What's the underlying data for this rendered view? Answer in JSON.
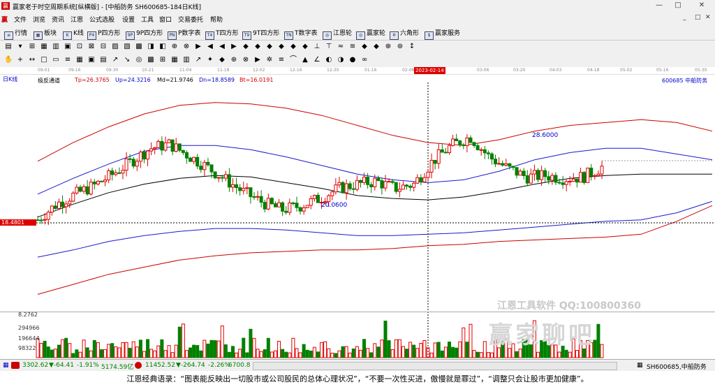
{
  "window": {
    "title": "赢家老于时空周期系统[纵横版] - [中船防务  SH600685-184日K线]",
    "min": "—",
    "max": "□",
    "close": "✕"
  },
  "menu": [
    "文件",
    "浏览",
    "资讯",
    "江恩",
    "公式选股",
    "设置",
    "工具",
    "窗口",
    "交易委托",
    "帮助"
  ],
  "mdi": [
    "_",
    "□",
    "✕"
  ],
  "nav": [
    {
      "label": "行情",
      "icon": "≡"
    },
    {
      "label": "板块",
      "icon": "▦"
    },
    {
      "label": "K线",
      "icon": "K"
    },
    {
      "label": "P四方形",
      "icon": "P4"
    },
    {
      "label": "9P四方形",
      "icon": "9P"
    },
    {
      "label": "P数字表",
      "icon": "PN"
    },
    {
      "label": "T四方形",
      "icon": "T4"
    },
    {
      "label": "9T四方形",
      "icon": "T9"
    },
    {
      "label": "T数字表",
      "icon": "TN"
    },
    {
      "label": "江恩轮",
      "icon": "◎"
    },
    {
      "label": "赢家轮",
      "icon": "◎"
    },
    {
      "label": "六角形",
      "icon": "✡"
    },
    {
      "label": "赢家服务",
      "icon": "$"
    }
  ],
  "dates": [
    "09-01",
    "09-16",
    "09-30",
    "10-21",
    "11-04",
    "11-18",
    "12-02",
    "12-16",
    "12-30",
    "01-16",
    "02-06",
    "02-14",
    "03-06",
    "03-20",
    "04-03",
    "04-18",
    "05-02",
    "05-16",
    "05-30"
  ],
  "highlight_date": "2023-02-14",
  "period": "日K线",
  "indicator": {
    "name": "极反通道",
    "tp": "Tp=26.3765",
    "up": "Up=24.3216",
    "md": "Md=21.9746",
    "dn": "Dn=18.8589",
    "bt": "Bt=16.0191"
  },
  "stock": "600685  中船防务",
  "annotations": {
    "high": "28.6000",
    "low": "20.0600"
  },
  "cursor_price": "18.4801",
  "volume_labels": {
    "top": "8.2762",
    "v1": "294966",
    "v2": "196644",
    "v3": "98322"
  },
  "watermark": {
    "line1": "江恩工具软件  QQ:100800360",
    "line2": "赢家聊吧"
  },
  "status": {
    "sh": "3302.62",
    "sh_chg": "▼-64.41",
    "sh_pct": "-1.91%",
    "sh_amt": "5174.59亿",
    "sz": "11452.52",
    "sz_chg": "▼-264.74",
    "sz_pct": "-2.26%",
    "sz_amt": "6700.8",
    "right": "SH600685,中船防务"
  },
  "quote": "江恩经典语录：“图表能反映出一切股市或公司股民的总体心理状况”，“不要一次性买进，傲慢就是罪过”，“调整只会让股市更加健康”。",
  "colors": {
    "up": "#e00000",
    "down": "#008000",
    "mid": "#000000",
    "band_blue": "#1a1acc",
    "band_red": "#cc0000"
  },
  "chart_data": {
    "type": "candlestick",
    "series": [
      {
        "name": "Tp",
        "values": [
          23.5,
          24.8,
          25.9,
          26.8,
          27.4,
          27.6,
          27.5,
          27.2,
          26.7,
          26.0,
          25.3,
          24.8,
          24.6,
          25.0,
          25.6,
          26.0,
          26.2,
          26.4,
          26.2,
          25.6
        ]
      },
      {
        "name": "Up",
        "values": [
          21.2,
          22.3,
          23.3,
          24.2,
          24.6,
          24.6,
          24.3,
          23.8,
          23.2,
          22.6,
          22.2,
          22.0,
          22.2,
          22.8,
          23.6,
          24.1,
          24.4,
          24.4,
          24.0,
          23.6
        ]
      },
      {
        "name": "Md",
        "values": [
          19.6,
          20.5,
          21.3,
          21.9,
          22.3,
          22.5,
          22.4,
          22.0,
          21.6,
          21.1,
          20.9,
          20.8,
          21.0,
          21.4,
          21.9,
          22.3,
          22.5,
          22.6,
          22.6,
          22.6
        ]
      },
      {
        "name": "Dn",
        "values": [
          16.8,
          17.3,
          17.9,
          18.3,
          18.6,
          18.8,
          18.8,
          18.7,
          18.5,
          18.3,
          18.3,
          18.4,
          18.5,
          18.7,
          18.9,
          19.1,
          19.3,
          19.4,
          19.9,
          20.7
        ]
      },
      {
        "name": "Bt",
        "values": [
          14.2,
          14.9,
          15.6,
          16.1,
          16.6,
          16.9,
          17.1,
          17.2,
          17.3,
          17.3,
          17.4,
          17.6,
          17.7,
          17.9,
          18.0,
          18.1,
          18.2,
          18.4,
          19.3,
          20.4
        ]
      }
    ],
    "ohlc_close": [
      19.4,
      20.5,
      21.2,
      21.8,
      22.6,
      23.5,
      24.4,
      24.7,
      23.9,
      23.1,
      22.2,
      21.3,
      20.6,
      20.1,
      20.4,
      20.9,
      21.6,
      21.9,
      22.1,
      21.6,
      21.9,
      23.5,
      24.6,
      25.2,
      23.8,
      23.0,
      22.4,
      22.5,
      22.3,
      22.4,
      23.1
    ],
    "annotations": [
      {
        "label": "28.6000"
      },
      {
        "label": "20.0600"
      }
    ]
  }
}
